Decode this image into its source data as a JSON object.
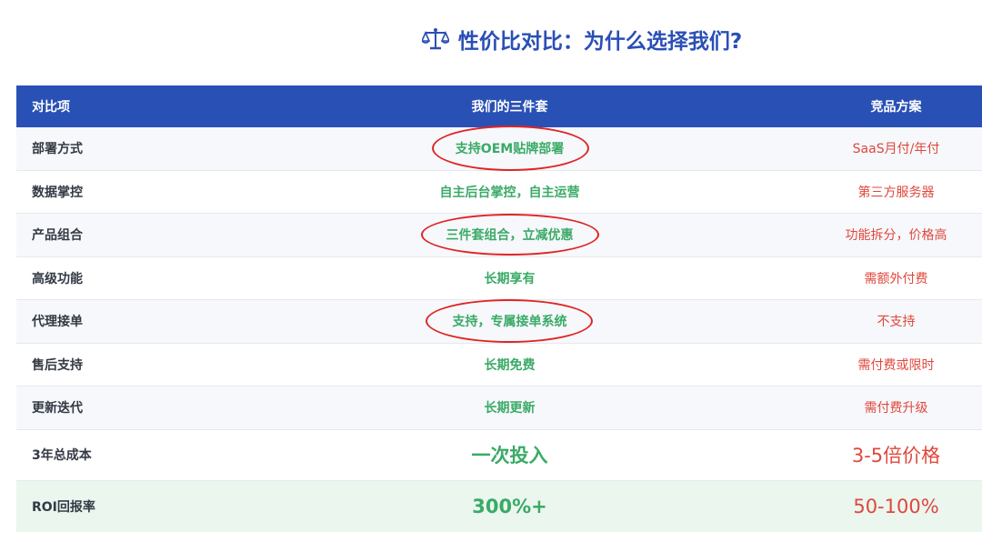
{
  "title": {
    "icon": "balance-scale-icon",
    "text": "性价比对比：为什么选择我们?"
  },
  "table": {
    "headers": [
      "对比项",
      "我们的三件套",
      "竞品方案"
    ],
    "rows": [
      {
        "item": "部署方式",
        "ours": "支持OEM贴牌部署",
        "competitor": "SaaS月付/年付",
        "circled": true
      },
      {
        "item": "数据掌控",
        "ours": "自主后台掌控，自主运营",
        "competitor": "第三方服务器",
        "circled": false
      },
      {
        "item": "产品组合",
        "ours": "三件套组合，立减优惠",
        "competitor": "功能拆分，价格高",
        "circled": true
      },
      {
        "item": "高级功能",
        "ours": "长期享有",
        "competitor": "需额外付费",
        "circled": false
      },
      {
        "item": "代理接单",
        "ours": "支持，专属接单系统",
        "competitor": "不支持",
        "circled": true
      },
      {
        "item": "售后支持",
        "ours": "长期免费",
        "competitor": "需付费或限时",
        "circled": false
      },
      {
        "item": "更新迭代",
        "ours": "长期更新",
        "competitor": "需付费升级",
        "circled": false
      },
      {
        "item": "3年总成本",
        "ours": "一次投入",
        "competitor": "3-5倍价格",
        "circled": false
      },
      {
        "item": "ROI回报率",
        "ours": "300%+",
        "competitor": "50-100%",
        "circled": false
      }
    ]
  },
  "colors": {
    "header_bg": "#2950b5",
    "title": "#2a4fb5",
    "ours_text": "#3aaa66",
    "competitor_text": "#e0473c",
    "annotation_circle": "#e02424",
    "roi_row_bg": "#eaf6ee"
  }
}
